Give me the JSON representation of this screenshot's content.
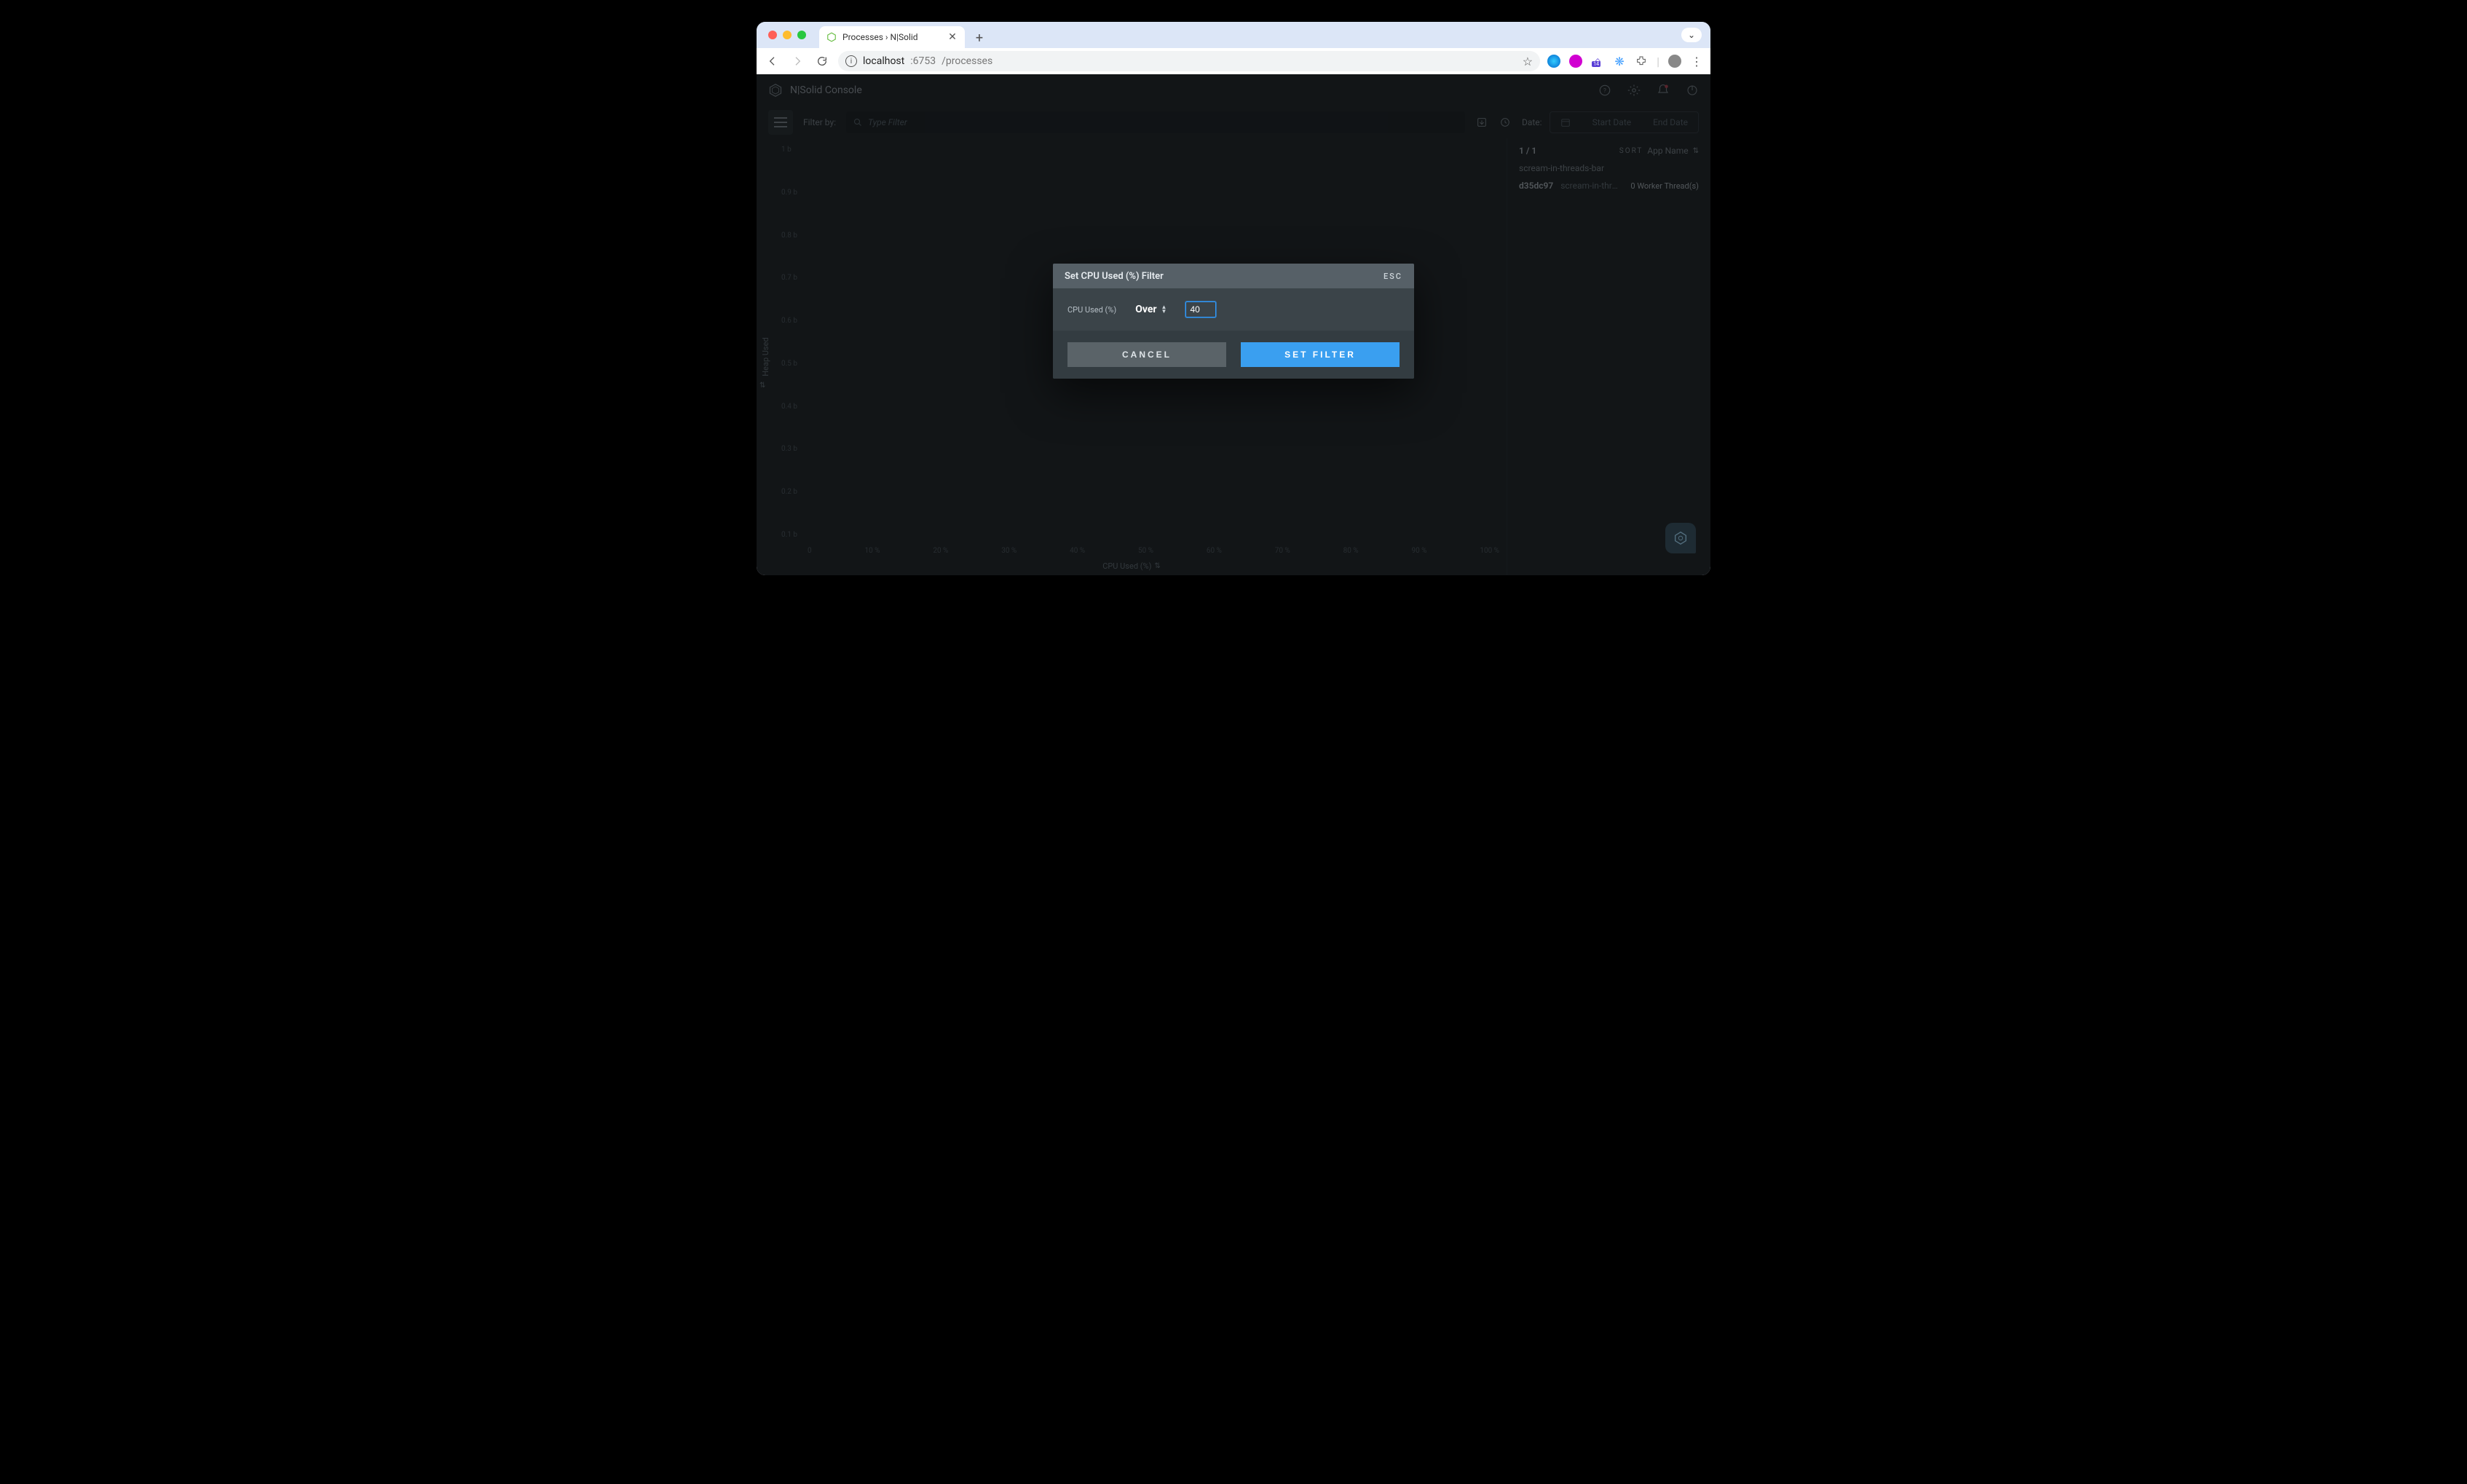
{
  "browser": {
    "tab_title": "Processes › N|Solid",
    "url_host": "localhost",
    "url_port": ":6753",
    "url_path": "/processes"
  },
  "app": {
    "title": "N|Solid Console",
    "filter_by_label": "Filter by:",
    "filter_placeholder": "Type Filter",
    "date_label": "Date:",
    "start_date_placeholder": "Start Date",
    "end_date_placeholder": "End Date"
  },
  "side": {
    "count": "1 / 1",
    "sort_label": "SORT",
    "sort_field": "App Name",
    "app_name": "scream-in-threads-bar",
    "process": {
      "id": "d35dc97",
      "name": "scream-in-threa…",
      "workers": "0 Worker Thread(s)"
    }
  },
  "chart_data": {
    "type": "scatter",
    "title": "",
    "xlabel": "CPU Used (%)",
    "ylabel": "Heap Used",
    "x_ticks": [
      "0",
      "10 %",
      "20 %",
      "30 %",
      "40 %",
      "50 %",
      "60 %",
      "70 %",
      "80 %",
      "90 %",
      "100 %"
    ],
    "y_ticks": [
      "1 b",
      "0.9 b",
      "0.8 b",
      "0.7 b",
      "0.6 b",
      "0.5 b",
      "0.4 b",
      "0.3 b",
      "0.2 b",
      "0.1 b"
    ],
    "xlim": [
      0,
      100
    ],
    "series": []
  },
  "modal": {
    "title": "Set CPU Used (%) Filter",
    "esc": "ESC",
    "field_label": "CPU Used (%)",
    "operator": "Over",
    "value": "40",
    "cancel": "CANCEL",
    "set": "SET FILTER"
  }
}
